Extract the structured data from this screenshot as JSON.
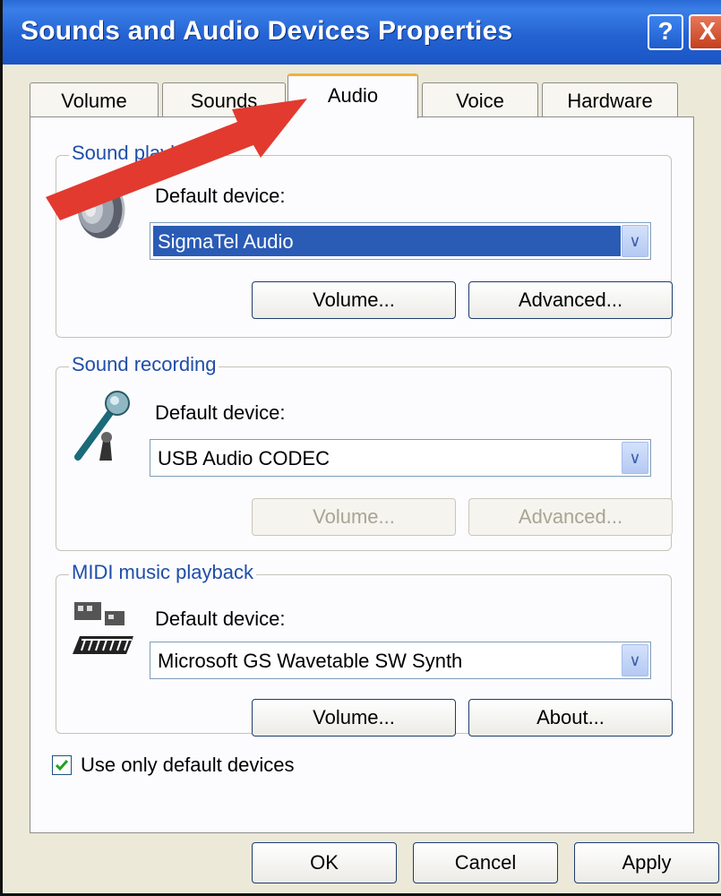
{
  "window": {
    "title": "Sounds and Audio Devices Properties",
    "help_label": "?",
    "close_label": "X"
  },
  "tabs": [
    {
      "label": "Volume"
    },
    {
      "label": "Sounds"
    },
    {
      "label": "Audio"
    },
    {
      "label": "Voice"
    },
    {
      "label": "Hardware"
    }
  ],
  "active_tab": "Audio",
  "sound_playback": {
    "group_label": "Sound playback",
    "device_label": "Default device:",
    "device_value": "SigmaTel Audio",
    "volume_button": "Volume...",
    "advanced_button": "Advanced...",
    "icon": "speaker-icon"
  },
  "sound_recording": {
    "group_label": "Sound recording",
    "device_label": "Default device:",
    "device_value": "USB Audio CODEC",
    "volume_button": "Volume...",
    "advanced_button": "Advanced...",
    "icon": "microphone-icon"
  },
  "midi_playback": {
    "group_label": "MIDI music playback",
    "device_label": "Default device:",
    "device_value": "Microsoft GS Wavetable SW Synth",
    "volume_button": "Volume...",
    "about_button": "About...",
    "icon": "midi-keyboard-icon"
  },
  "use_default_devices": {
    "label": "Use only default devices",
    "checked": true
  },
  "footer": {
    "ok": "OK",
    "cancel": "Cancel",
    "apply": "Apply"
  },
  "colors": {
    "titlebar": "#2463d3",
    "selection": "#2a5bb5",
    "arrow": "#e23a2f",
    "active_tab_accent": "#f2b13b"
  }
}
